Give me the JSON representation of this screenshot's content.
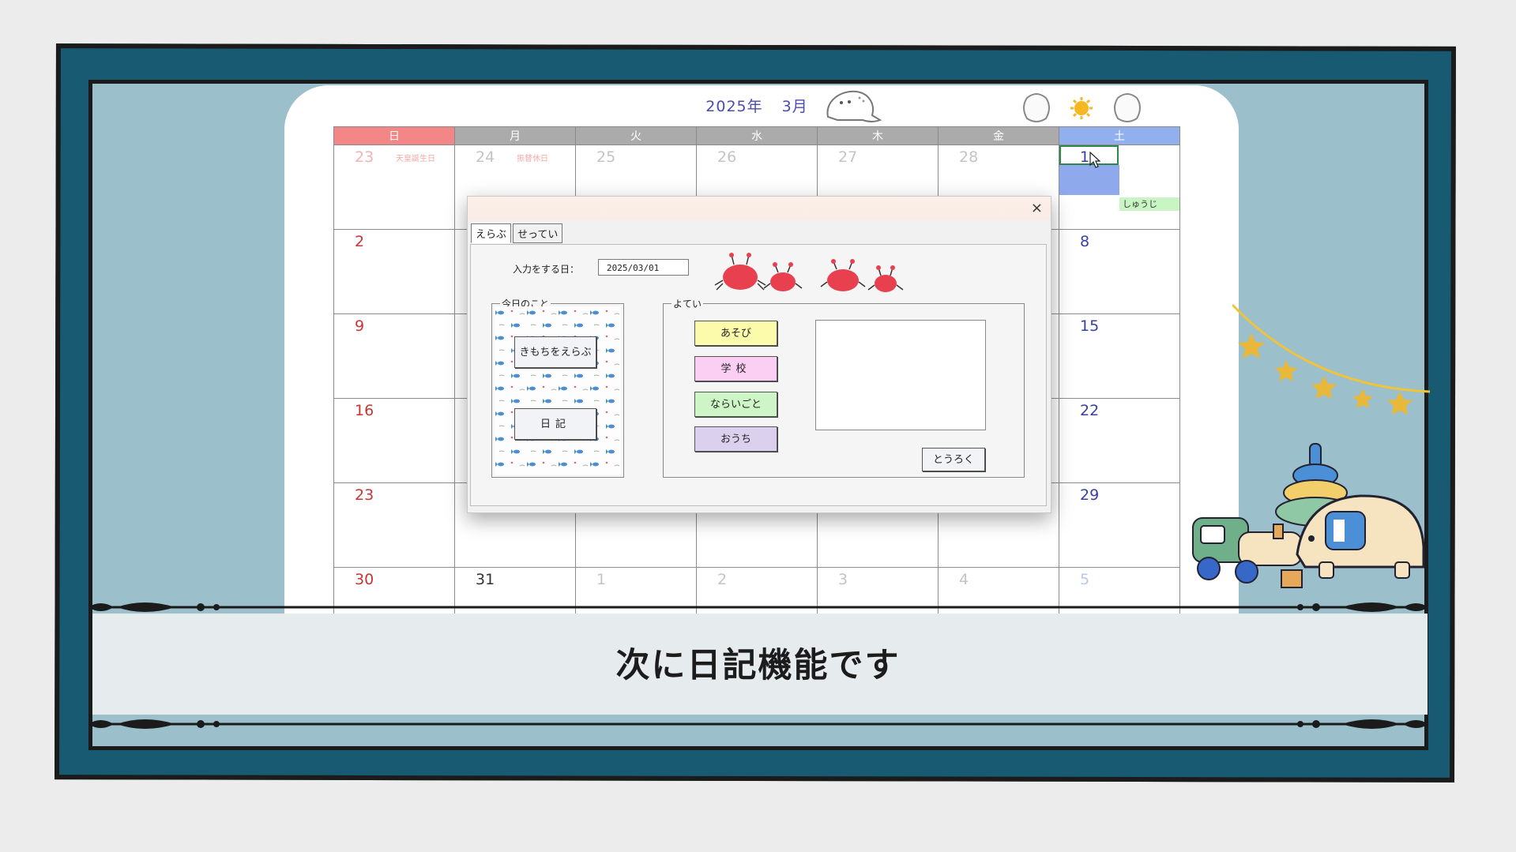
{
  "calendar": {
    "year_label": "2025年",
    "month_label": "3月",
    "weekdays": [
      "日",
      "月",
      "火",
      "水",
      "木",
      "金",
      "土"
    ],
    "weeks": [
      [
        {
          "day": "23",
          "holiday": "天皇誕生日"
        },
        {
          "day": "24",
          "holiday": "振替休日"
        },
        {
          "day": "25"
        },
        {
          "day": "26"
        },
        {
          "day": "27"
        },
        {
          "day": "28"
        },
        {
          "day": "1",
          "event": "しゅうじ"
        }
      ],
      [
        {
          "day": "2"
        },
        {
          "day": ""
        },
        {
          "day": ""
        },
        {
          "day": ""
        },
        {
          "day": ""
        },
        {
          "day": ""
        },
        {
          "day": "8"
        }
      ],
      [
        {
          "day": "9"
        },
        {
          "day": ""
        },
        {
          "day": ""
        },
        {
          "day": ""
        },
        {
          "day": ""
        },
        {
          "day": ""
        },
        {
          "day": "15"
        }
      ],
      [
        {
          "day": "16"
        },
        {
          "day": ""
        },
        {
          "day": ""
        },
        {
          "day": ""
        },
        {
          "day": ""
        },
        {
          "day": ""
        },
        {
          "day": "22"
        }
      ],
      [
        {
          "day": "23"
        },
        {
          "day": ""
        },
        {
          "day": ""
        },
        {
          "day": ""
        },
        {
          "day": ""
        },
        {
          "day": ""
        },
        {
          "day": "29"
        }
      ],
      [
        {
          "day": "30"
        },
        {
          "day": "31"
        },
        {
          "day": "1"
        },
        {
          "day": "2"
        },
        {
          "day": "3"
        },
        {
          "day": "4"
        },
        {
          "day": "5"
        }
      ]
    ]
  },
  "dialog": {
    "tabs": [
      "えらぶ",
      "せってい"
    ],
    "date_label": "入力をする日：",
    "date_value": "2025/03/01",
    "today_group_label": "今日のこと",
    "kimochi_button": "きもちをえらぶ",
    "nikki_button": "日記",
    "yotei_group_label": "よてい",
    "category_buttons": {
      "asobi": "あそび",
      "gakkou": "学校",
      "naraigoto": "ならいごと",
      "ouchi": "おうち"
    },
    "touroku_button": "とうろく",
    "close_icon": "×"
  },
  "caption": "次に日記機能です",
  "colors": {
    "frame_outer": "#185a72",
    "frame_inner": "#9bbfcb",
    "sunday_header": "#f38686",
    "saturday_header": "#93b0ee",
    "selected_cell": "#8ea9ec",
    "event_fill": "#c9f5c5"
  }
}
